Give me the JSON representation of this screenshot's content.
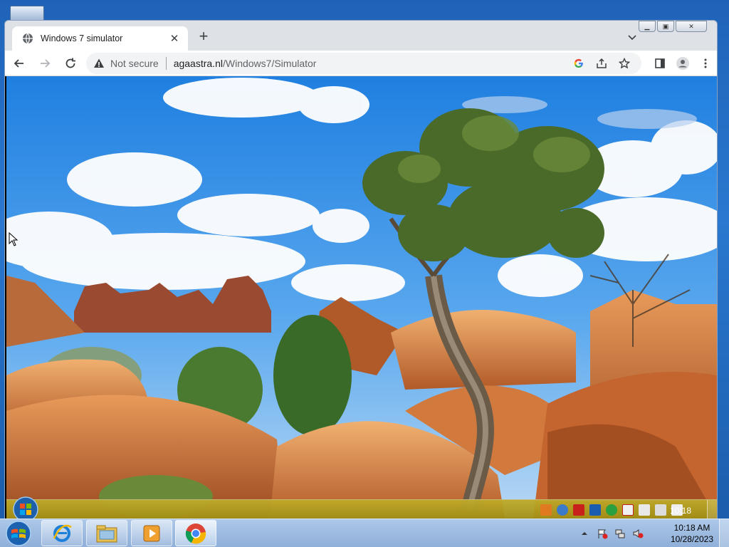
{
  "browser": {
    "tab_title": "Windows 7 simulator",
    "new_tab_label": "+",
    "security_label": "Not secure",
    "url_domain": "agaastra.nl",
    "url_path": "/Windows7/Simulator"
  },
  "inner_desktop": {
    "clock": "10:18"
  },
  "taskbar": {
    "apps": [
      "internet-explorer-icon",
      "file-explorer-icon",
      "media-player-icon",
      "chrome-icon"
    ],
    "time": "10:18 AM",
    "date": "10/28/2023"
  },
  "colors": {
    "sky": "#2a88e0",
    "rock": "#c8703a",
    "taskbar_inner": "#a89018",
    "taskbar_outer": "#9cb8dc"
  }
}
